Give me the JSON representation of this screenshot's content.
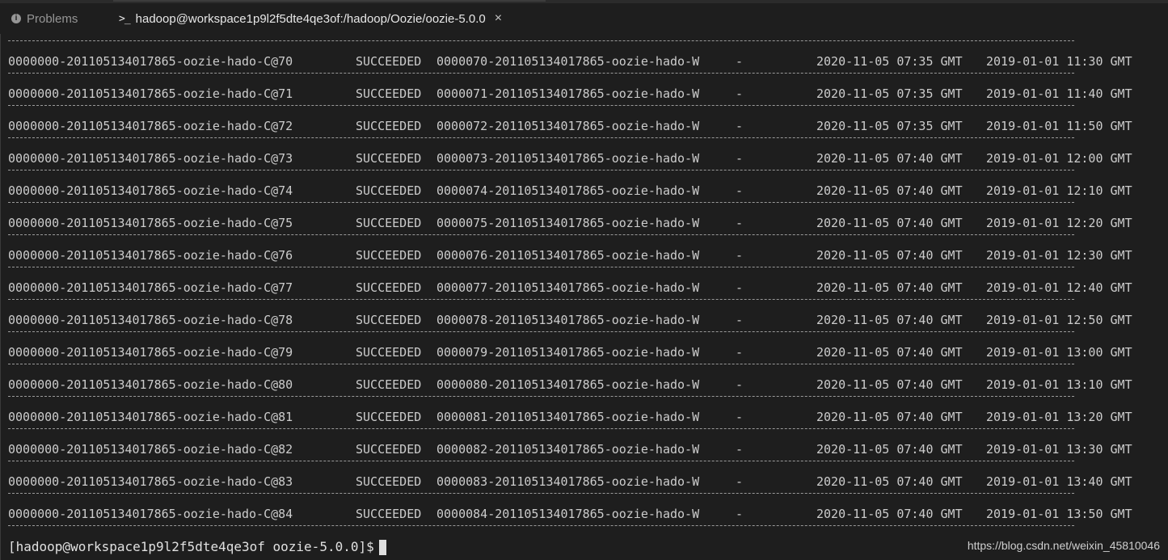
{
  "tabs": {
    "problems": {
      "label": "Problems",
      "icon": "info-icon"
    },
    "terminal": {
      "label": "hadoop@workspace1p9l2f5dte4qe3of:/hadoop/Oozie/oozie-5.0.0",
      "icon": "terminal-icon",
      "close_glyph": "×"
    }
  },
  "terminal": {
    "separator": "------------------------------------------------------------------------------------------------------------------------------------",
    "rows": [
      {
        "job": "0000000-201105134017865-oozie-hado-C@70",
        "status": "SUCCEEDED",
        "ext_id": "0000070-201105134017865-oozie-hado-W",
        "err": "-",
        "created": "2020-11-05 07:35 GMT",
        "nominal": "2019-01-01 11:30 GMT"
      },
      {
        "job": "0000000-201105134017865-oozie-hado-C@71",
        "status": "SUCCEEDED",
        "ext_id": "0000071-201105134017865-oozie-hado-W",
        "err": "-",
        "created": "2020-11-05 07:35 GMT",
        "nominal": "2019-01-01 11:40 GMT"
      },
      {
        "job": "0000000-201105134017865-oozie-hado-C@72",
        "status": "SUCCEEDED",
        "ext_id": "0000072-201105134017865-oozie-hado-W",
        "err": "-",
        "created": "2020-11-05 07:35 GMT",
        "nominal": "2019-01-01 11:50 GMT"
      },
      {
        "job": "0000000-201105134017865-oozie-hado-C@73",
        "status": "SUCCEEDED",
        "ext_id": "0000073-201105134017865-oozie-hado-W",
        "err": "-",
        "created": "2020-11-05 07:40 GMT",
        "nominal": "2019-01-01 12:00 GMT"
      },
      {
        "job": "0000000-201105134017865-oozie-hado-C@74",
        "status": "SUCCEEDED",
        "ext_id": "0000074-201105134017865-oozie-hado-W",
        "err": "-",
        "created": "2020-11-05 07:40 GMT",
        "nominal": "2019-01-01 12:10 GMT"
      },
      {
        "job": "0000000-201105134017865-oozie-hado-C@75",
        "status": "SUCCEEDED",
        "ext_id": "0000075-201105134017865-oozie-hado-W",
        "err": "-",
        "created": "2020-11-05 07:40 GMT",
        "nominal": "2019-01-01 12:20 GMT"
      },
      {
        "job": "0000000-201105134017865-oozie-hado-C@76",
        "status": "SUCCEEDED",
        "ext_id": "0000076-201105134017865-oozie-hado-W",
        "err": "-",
        "created": "2020-11-05 07:40 GMT",
        "nominal": "2019-01-01 12:30 GMT"
      },
      {
        "job": "0000000-201105134017865-oozie-hado-C@77",
        "status": "SUCCEEDED",
        "ext_id": "0000077-201105134017865-oozie-hado-W",
        "err": "-",
        "created": "2020-11-05 07:40 GMT",
        "nominal": "2019-01-01 12:40 GMT"
      },
      {
        "job": "0000000-201105134017865-oozie-hado-C@78",
        "status": "SUCCEEDED",
        "ext_id": "0000078-201105134017865-oozie-hado-W",
        "err": "-",
        "created": "2020-11-05 07:40 GMT",
        "nominal": "2019-01-01 12:50 GMT"
      },
      {
        "job": "0000000-201105134017865-oozie-hado-C@79",
        "status": "SUCCEEDED",
        "ext_id": "0000079-201105134017865-oozie-hado-W",
        "err": "-",
        "created": "2020-11-05 07:40 GMT",
        "nominal": "2019-01-01 13:00 GMT"
      },
      {
        "job": "0000000-201105134017865-oozie-hado-C@80",
        "status": "SUCCEEDED",
        "ext_id": "0000080-201105134017865-oozie-hado-W",
        "err": "-",
        "created": "2020-11-05 07:40 GMT",
        "nominal": "2019-01-01 13:10 GMT"
      },
      {
        "job": "0000000-201105134017865-oozie-hado-C@81",
        "status": "SUCCEEDED",
        "ext_id": "0000081-201105134017865-oozie-hado-W",
        "err": "-",
        "created": "2020-11-05 07:40 GMT",
        "nominal": "2019-01-01 13:20 GMT"
      },
      {
        "job": "0000000-201105134017865-oozie-hado-C@82",
        "status": "SUCCEEDED",
        "ext_id": "0000082-201105134017865-oozie-hado-W",
        "err": "-",
        "created": "2020-11-05 07:40 GMT",
        "nominal": "2019-01-01 13:30 GMT"
      },
      {
        "job": "0000000-201105134017865-oozie-hado-C@83",
        "status": "SUCCEEDED",
        "ext_id": "0000083-201105134017865-oozie-hado-W",
        "err": "-",
        "created": "2020-11-05 07:40 GMT",
        "nominal": "2019-01-01 13:40 GMT"
      },
      {
        "job": "0000000-201105134017865-oozie-hado-C@84",
        "status": "SUCCEEDED",
        "ext_id": "0000084-201105134017865-oozie-hado-W",
        "err": "-",
        "created": "2020-11-05 07:40 GMT",
        "nominal": "2019-01-01 13:50 GMT"
      }
    ],
    "prompt": "[hadoop@workspace1p9l2f5dte4qe3of oozie-5.0.0]$"
  },
  "watermark": "https://blog.csdn.net/weixin_45810046",
  "colors": {
    "background": "#1e1e1e",
    "text": "#cccccc",
    "tab_active": "#e7e7e7",
    "tab_inactive": "#969696"
  }
}
